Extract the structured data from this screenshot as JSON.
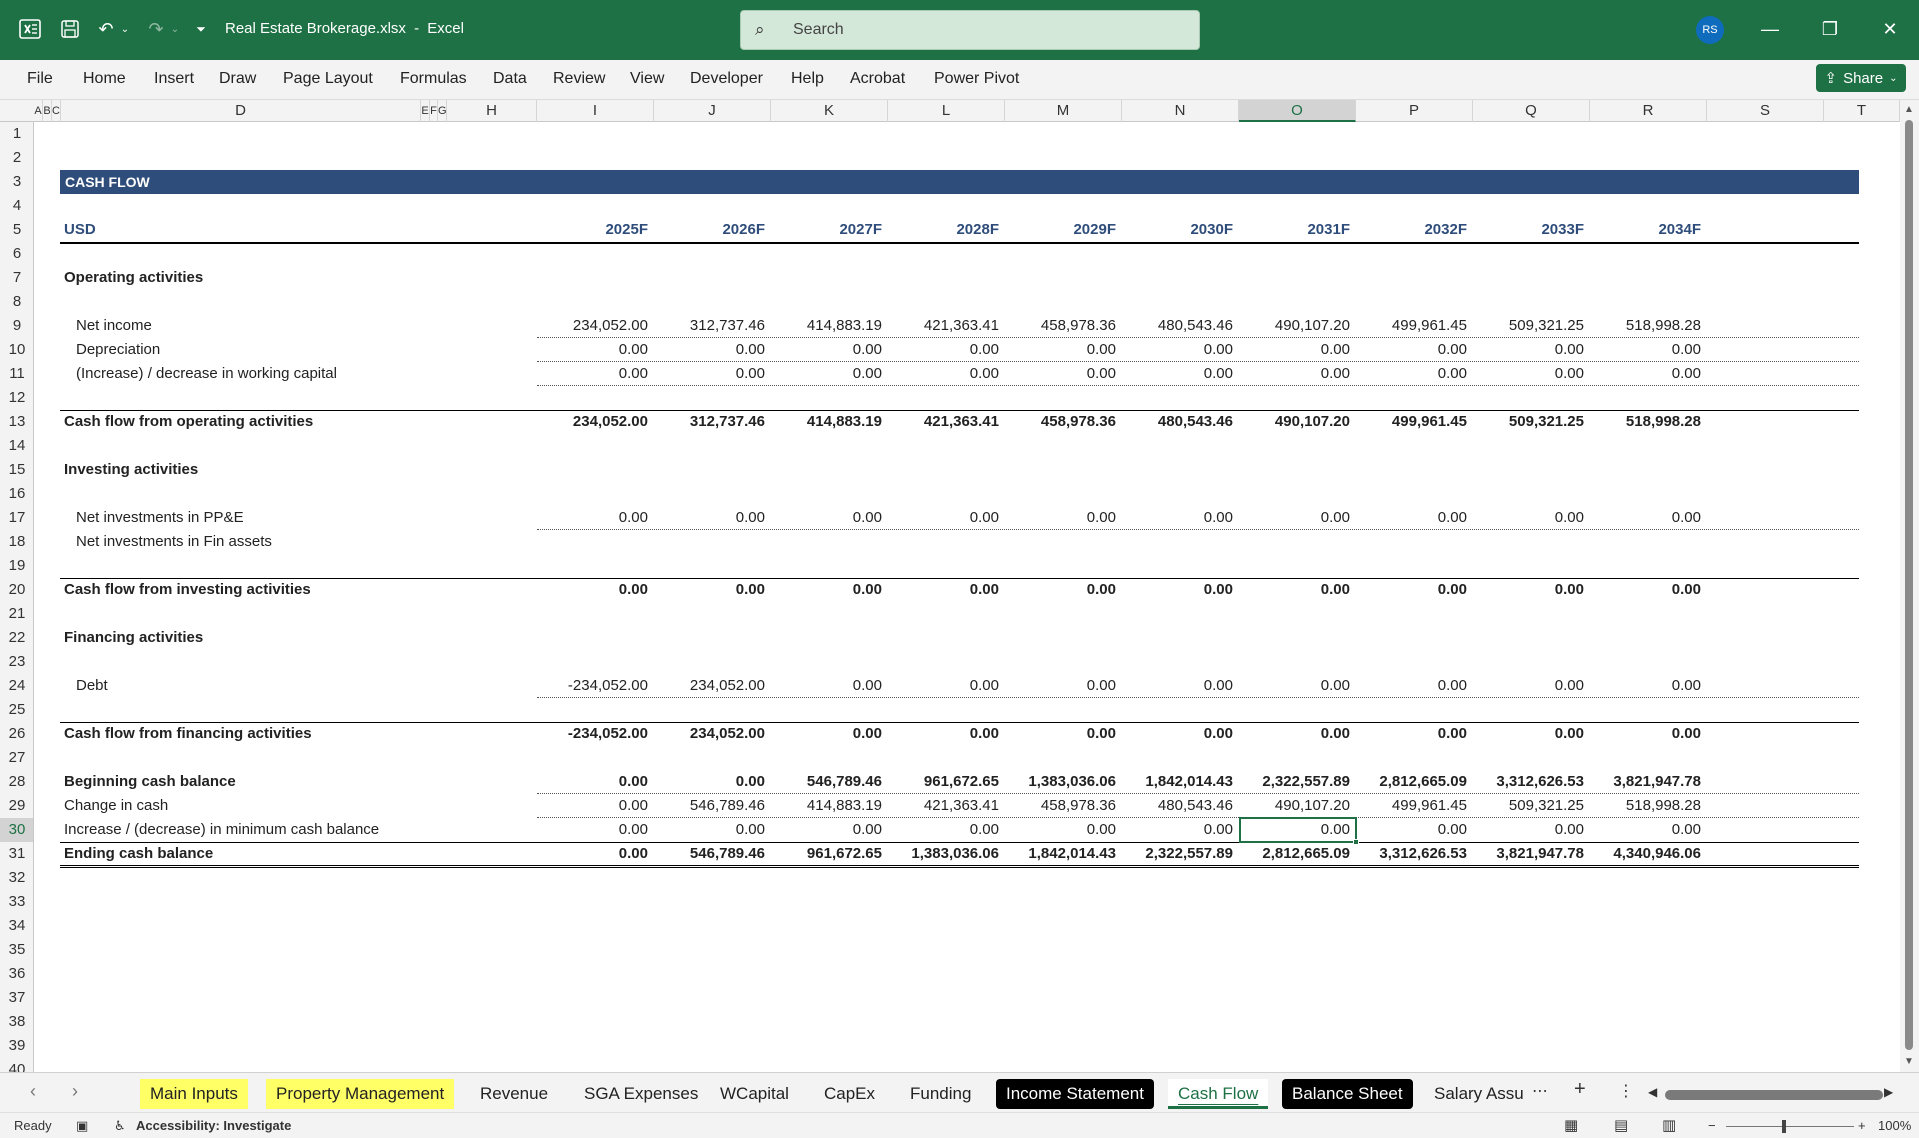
{
  "titlebar": {
    "filename": "Real Estate Brokerage.xlsx",
    "separator": "-",
    "app": "Excel",
    "search_placeholder": "Search",
    "avatar_initials": "RS"
  },
  "menu": [
    "File",
    "Home",
    "Insert",
    "Draw",
    "Page Layout",
    "Formulas",
    "Data",
    "Review",
    "View",
    "Developer",
    "Help",
    "Acrobat",
    "Power Pivot"
  ],
  "share_label": "Share",
  "columns": [
    "A",
    "B",
    "C",
    "D",
    "E",
    "F",
    "G",
    "H",
    "I",
    "J",
    "K",
    "L",
    "M",
    "N",
    "O",
    "P",
    "Q",
    "R",
    "S",
    "T"
  ],
  "rows": [
    "1",
    "2",
    "3",
    "4",
    "5",
    "6",
    "7",
    "8",
    "9",
    "10",
    "11",
    "12",
    "13",
    "14",
    "15",
    "16",
    "17",
    "18",
    "19",
    "20",
    "21",
    "22",
    "23",
    "24",
    "25",
    "26",
    "27",
    "28",
    "29",
    "30",
    "31",
    "32",
    "33",
    "34",
    "35",
    "36",
    "37",
    "38",
    "39",
    "40"
  ],
  "sheet": {
    "section_title": "CASH FLOW",
    "currency": "USD",
    "years": [
      "2025F",
      "2026F",
      "2027F",
      "2028F",
      "2029F",
      "2030F",
      "2031F",
      "2032F",
      "2033F",
      "2034F"
    ],
    "operating_header": "Operating activities",
    "net_income": {
      "label": "Net income",
      "values": [
        "234,052.00",
        "312,737.46",
        "414,883.19",
        "421,363.41",
        "458,978.36",
        "480,543.46",
        "490,107.20",
        "499,961.45",
        "509,321.25",
        "518,998.28"
      ]
    },
    "depreciation": {
      "label": "Depreciation",
      "values": [
        "0.00",
        "0.00",
        "0.00",
        "0.00",
        "0.00",
        "0.00",
        "0.00",
        "0.00",
        "0.00",
        "0.00"
      ]
    },
    "working_capital": {
      "label": "(Increase) / decrease in working capital",
      "values": [
        "0.00",
        "0.00",
        "0.00",
        "0.00",
        "0.00",
        "0.00",
        "0.00",
        "0.00",
        "0.00",
        "0.00"
      ]
    },
    "cf_operating": {
      "label": "Cash flow from operating activities",
      "values": [
        "234,052.00",
        "312,737.46",
        "414,883.19",
        "421,363.41",
        "458,978.36",
        "480,543.46",
        "490,107.20",
        "499,961.45",
        "509,321.25",
        "518,998.28"
      ]
    },
    "investing_header": "Investing activities",
    "ppe": {
      "label": "Net investments in PP&E",
      "values": [
        "0.00",
        "0.00",
        "0.00",
        "0.00",
        "0.00",
        "0.00",
        "0.00",
        "0.00",
        "0.00",
        "0.00"
      ]
    },
    "fin_assets": {
      "label": "Net investments in Fin assets",
      "values": [
        "",
        "",
        "",
        "",
        "",
        "",
        "",
        "",
        "",
        ""
      ]
    },
    "cf_investing": {
      "label": "Cash flow from investing activities",
      "values": [
        "0.00",
        "0.00",
        "0.00",
        "0.00",
        "0.00",
        "0.00",
        "0.00",
        "0.00",
        "0.00",
        "0.00"
      ]
    },
    "financing_header": "Financing activities",
    "debt": {
      "label": "Debt",
      "values": [
        "-234,052.00",
        "234,052.00",
        "0.00",
        "0.00",
        "0.00",
        "0.00",
        "0.00",
        "0.00",
        "0.00",
        "0.00"
      ]
    },
    "cf_financing": {
      "label": "Cash flow from financing activities",
      "values": [
        "-234,052.00",
        "234,052.00",
        "0.00",
        "0.00",
        "0.00",
        "0.00",
        "0.00",
        "0.00",
        "0.00",
        "0.00"
      ]
    },
    "beginning_cash": {
      "label": "Beginning cash balance",
      "values": [
        "0.00",
        "0.00",
        "546,789.46",
        "961,672.65",
        "1,383,036.06",
        "1,842,014.43",
        "2,322,557.89",
        "2,812,665.09",
        "3,312,626.53",
        "3,821,947.78"
      ]
    },
    "change_cash": {
      "label": "Change in cash",
      "values": [
        "0.00",
        "546,789.46",
        "414,883.19",
        "421,363.41",
        "458,978.36",
        "480,543.46",
        "490,107.20",
        "499,961.45",
        "509,321.25",
        "518,998.28"
      ]
    },
    "min_cash": {
      "label": "Increase / (decrease) in minimum cash balance",
      "values": [
        "0.00",
        "0.00",
        "0.00",
        "0.00",
        "0.00",
        "0.00",
        "0.00",
        "0.00",
        "0.00",
        "0.00"
      ]
    },
    "ending_cash": {
      "label": "Ending cash balance",
      "values": [
        "0.00",
        "546,789.46",
        "961,672.65",
        "1,383,036.06",
        "1,842,014.43",
        "2,322,557.89",
        "2,812,665.09",
        "3,312,626.53",
        "3,821,947.78",
        "4,340,946.06"
      ]
    }
  },
  "tabs": [
    {
      "label": "Main Inputs",
      "style": "yellow"
    },
    {
      "label": "Property Management",
      "style": "yellow"
    },
    {
      "label": "Revenue",
      "style": "plain"
    },
    {
      "label": "SGA Expenses",
      "style": "plain"
    },
    {
      "label": "WCapital",
      "style": "plain"
    },
    {
      "label": "CapEx",
      "style": "plain"
    },
    {
      "label": "Funding",
      "style": "plain"
    },
    {
      "label": "Income Statement",
      "style": "black"
    },
    {
      "label": "Cash Flow",
      "style": "active"
    },
    {
      "label": "Balance Sheet",
      "style": "black"
    },
    {
      "label": "Salary Assu",
      "style": "plain"
    }
  ],
  "status": {
    "ready": "Ready",
    "accessibility": "Accessibility: Investigate",
    "zoom": "100%"
  },
  "active_cell": "O30"
}
